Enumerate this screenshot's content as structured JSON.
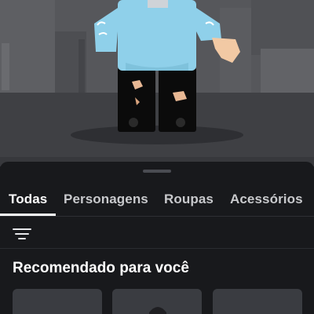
{
  "tabs": [
    {
      "label": "Todas",
      "active": true
    },
    {
      "label": "Personagens",
      "active": false
    },
    {
      "label": "Roupas",
      "active": false
    },
    {
      "label": "Acessórios",
      "active": false
    }
  ],
  "filter": {
    "icon": "filter-icon"
  },
  "recommended": {
    "title": "Recomendado para você",
    "cards": [
      {
        "icon": ""
      },
      {
        "icon": "avatar-thumbnail"
      },
      {
        "icon": ""
      }
    ]
  },
  "colors": {
    "sheet_background": "#18191c",
    "active_tab": "#ffffff",
    "inactive_tab": "#c8c9cc",
    "shirt": "#8fd0ea",
    "pants": "#0b0b0b",
    "skin": "#f2c9a4"
  }
}
